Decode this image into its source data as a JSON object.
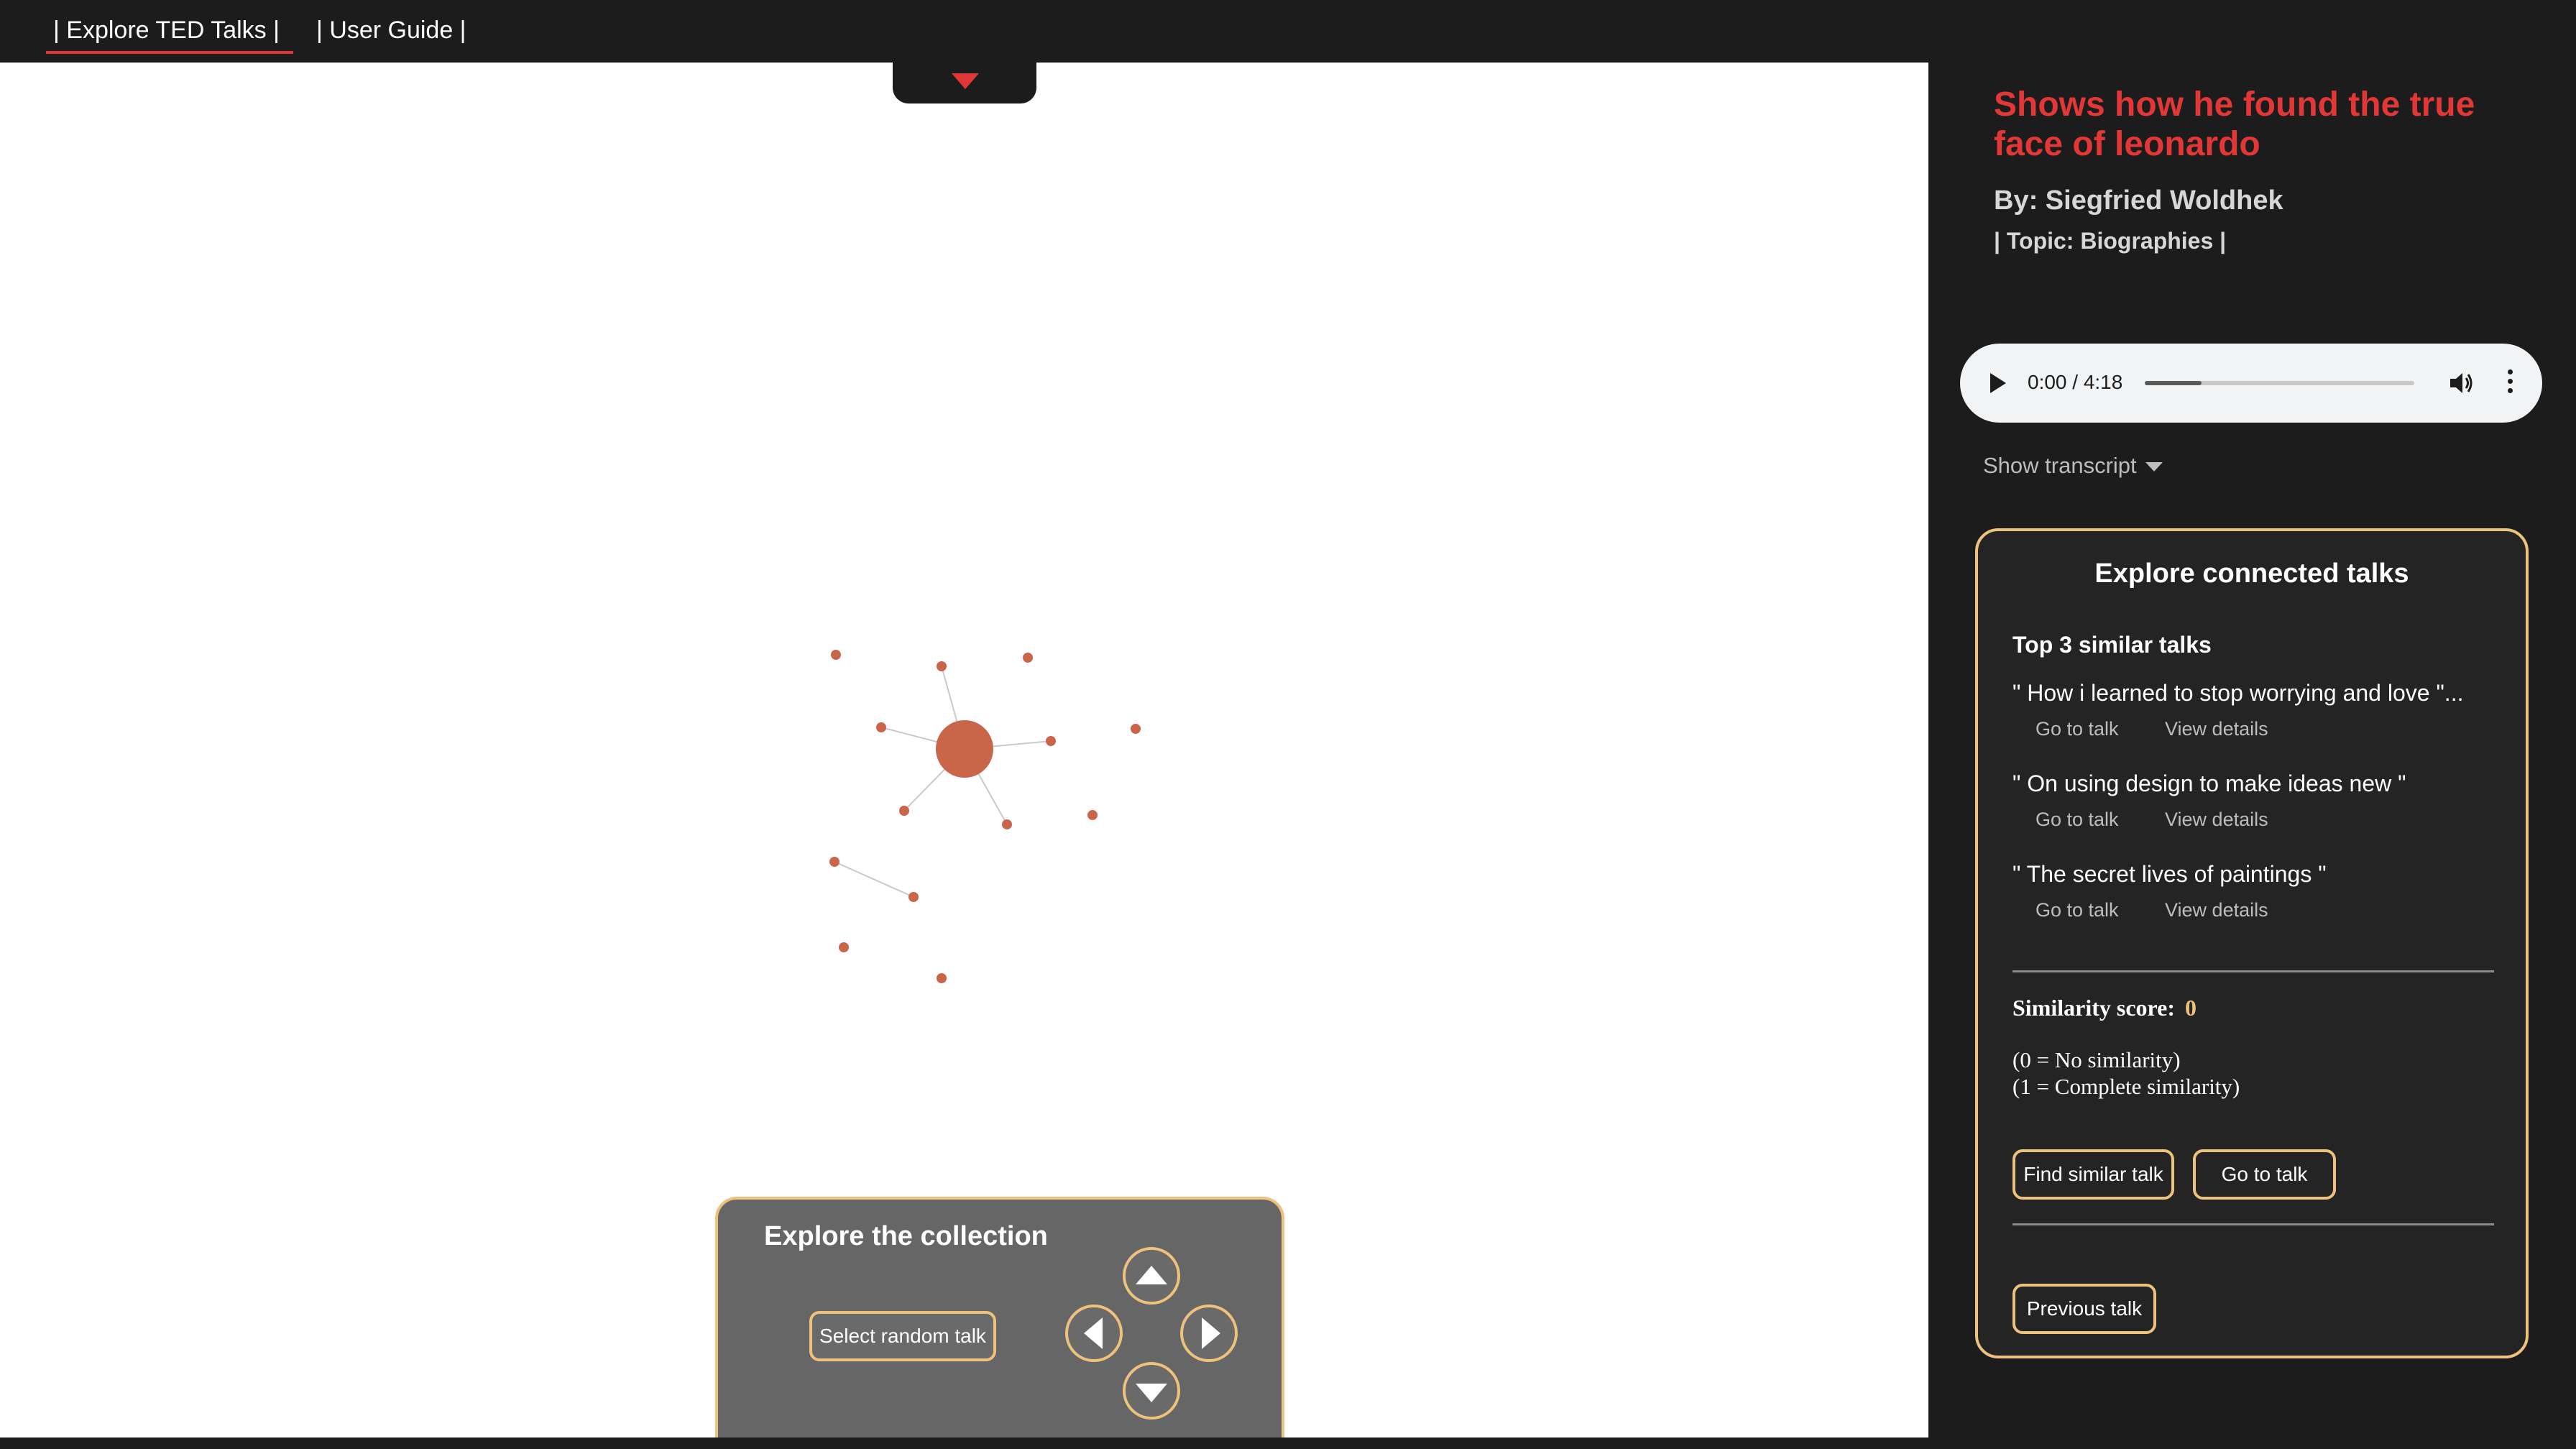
{
  "nav": {
    "items": [
      {
        "label": "| Explore TED Talks |"
      },
      {
        "label": "| User Guide |"
      }
    ]
  },
  "explore": {
    "title": "Explore the collection",
    "random_label": "Select random talk"
  },
  "talk": {
    "title": "Shows how he found the true face of leonardo",
    "author": "By: Siegfried Woldhek",
    "topic": "| Topic: Biographies |"
  },
  "audio": {
    "time": "0:00 / 4:18",
    "progress": 0.21
  },
  "transcript": {
    "label": "Show transcript"
  },
  "connected": {
    "title": "Explore connected talks",
    "top3_heading": "Top 3 similar talks",
    "go_label": "Go to talk",
    "details_label": "View details",
    "similar": [
      {
        "title": "\" How i learned to stop worrying and love \"..."
      },
      {
        "title": "\" On using design to make ideas new \""
      },
      {
        "title": "\" The secret lives of paintings \""
      }
    ],
    "score_label": "Similarity score:",
    "score_value": "0",
    "legend": [
      "(0 = No similarity)",
      "(1 = Complete similarity)"
    ],
    "find_label": "Find similar talk",
    "goto_label": "Go to talk",
    "prev_label": "Previous talk"
  },
  "colors": {
    "accent_red": "#e13737",
    "accent_gold": "#eec27d",
    "node": "#c9664a",
    "dark_bg": "#1c1c1c"
  }
}
